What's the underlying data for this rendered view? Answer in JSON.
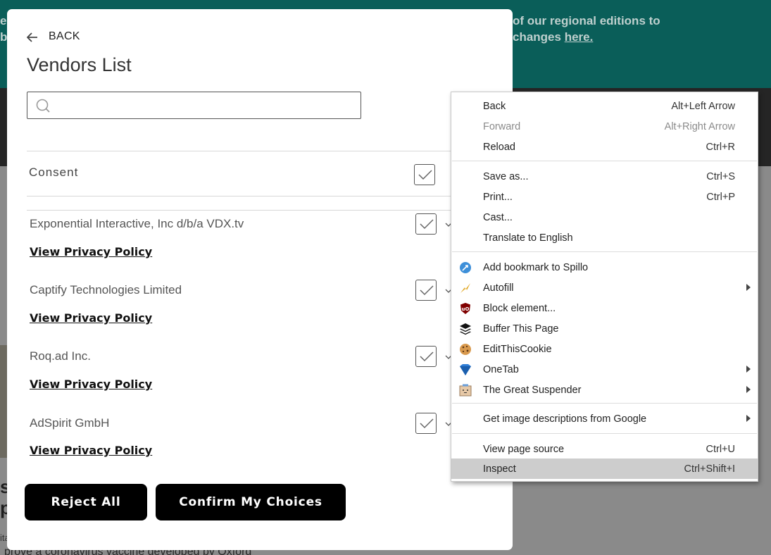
{
  "background": {
    "banner_left": [
      "e",
      "b"
    ],
    "banner_line1": "of our regional editions to",
    "banner_line2_prefix": "changes ",
    "banner_link": "here.",
    "stub_1": "s",
    "stub_2": "p",
    "stub_3": "ita",
    "footer_text": "prove a coronavirus vaccine developed by Oxford"
  },
  "modal": {
    "back_label": "BACK",
    "title": "Vendors List",
    "search_placeholder": "",
    "consent_label": "Consent",
    "vendors": [
      {
        "name": "Exponential Interactive, Inc d/b/a VDX.tv",
        "link": "View Privacy Policy "
      },
      {
        "name": "Captify Technologies Limited",
        "link": "View Privacy Policy "
      },
      {
        "name": "Roq.ad Inc.",
        "link": "View Privacy Policy "
      },
      {
        "name": "AdSpirit GmbH",
        "link": "View Privacy Policy "
      }
    ],
    "reject_label": "Reject All",
    "confirm_label": "Confirm My Choices"
  },
  "context_menu": {
    "items": [
      {
        "label": "Back",
        "shortcut": "Alt+Left Arrow"
      },
      {
        "label": "Forward",
        "shortcut": "Alt+Right Arrow",
        "disabled": true
      },
      {
        "label": "Reload",
        "shortcut": "Ctrl+R"
      },
      {
        "label": "Save as...",
        "shortcut": "Ctrl+S"
      },
      {
        "label": "Print...",
        "shortcut": "Ctrl+P"
      },
      {
        "label": "Cast...",
        "shortcut": ""
      },
      {
        "label": "Translate to English",
        "shortcut": ""
      },
      {
        "label": "Add bookmark to Spillo",
        "icon": "spillo-icon"
      },
      {
        "label": "Autofill",
        "icon": "autofill-icon",
        "submenu": true
      },
      {
        "label": "Block element...",
        "icon": "ublock-icon"
      },
      {
        "label": "Buffer This Page",
        "icon": "buffer-icon"
      },
      {
        "label": "EditThisCookie",
        "icon": "cookie-icon"
      },
      {
        "label": "OneTab",
        "icon": "onetab-icon",
        "submenu": true
      },
      {
        "label": "The Great Suspender",
        "icon": "great-suspender-icon",
        "submenu": true
      },
      {
        "label": "Get image descriptions from Google",
        "submenu": true
      },
      {
        "label": "View page source",
        "shortcut": "Ctrl+U"
      },
      {
        "label": "Inspect",
        "shortcut": "Ctrl+Shift+I",
        "hover": true
      }
    ]
  },
  "colors": {
    "banner": "#0a5e59",
    "menu_hover": "#cdcdcd",
    "button": "#000000"
  }
}
